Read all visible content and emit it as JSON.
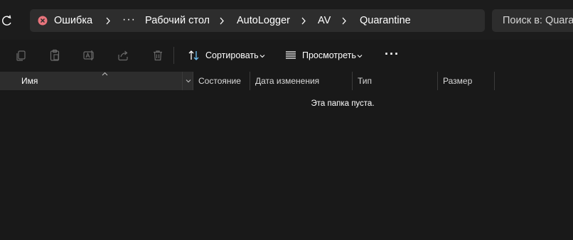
{
  "address_bar": {
    "breadcrumbs": [
      {
        "label": "Ошибка"
      },
      {
        "label": "Рабочий стол"
      },
      {
        "label": "AutoLogger"
      },
      {
        "label": "AV"
      },
      {
        "label": "Quarantine"
      }
    ],
    "overflow": "···",
    "status_icon": "error-icon",
    "status_color": "#e8747c"
  },
  "search": {
    "placeholder": "Поиск в: Quarantine"
  },
  "toolbar": {
    "icons": [
      "copy-icon",
      "paste-icon",
      "rename-icon",
      "share-icon",
      "delete-icon"
    ],
    "sort_label": "Сортировать",
    "view_label": "Просмотреть",
    "more_label": "···"
  },
  "columns": {
    "name": "Имя",
    "status": "Состояние",
    "date_modified": "Дата изменения",
    "type": "Тип",
    "size": "Размер"
  },
  "empty_message": "Эта папка пуста."
}
